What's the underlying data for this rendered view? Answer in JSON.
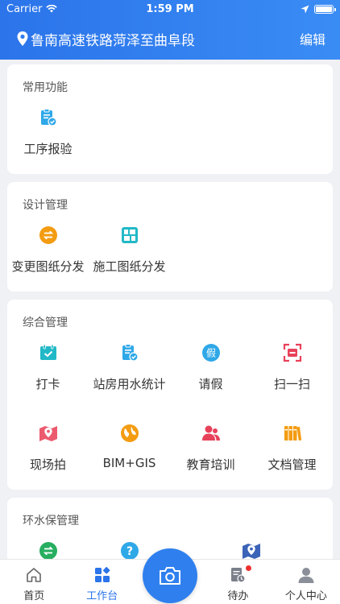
{
  "status": {
    "carrier": "Carrier",
    "time": "1:59 PM"
  },
  "header": {
    "title": "鲁南高速铁路菏泽至曲阜段",
    "edit": "编辑"
  },
  "sections": [
    {
      "title": "常用功能",
      "items": [
        {
          "label": "工序报验",
          "icon": "clipboard-check-icon"
        }
      ]
    },
    {
      "title": "设计管理",
      "items": [
        {
          "label": "变更图纸分发",
          "icon": "exchange-icon"
        },
        {
          "label": "施工图纸分发",
          "icon": "blueprint-icon"
        }
      ]
    },
    {
      "title": "综合管理",
      "items": [
        {
          "label": "打卡",
          "icon": "calendar-check-icon"
        },
        {
          "label": "站房用水统计",
          "icon": "clipboard-check-icon"
        },
        {
          "label": "请假",
          "icon": "leave-icon"
        },
        {
          "label": "扫一扫",
          "icon": "scan-icon"
        },
        {
          "label": "现场拍",
          "icon": "map-pin-icon"
        },
        {
          "label": "BIM+GIS",
          "icon": "globe-icon"
        },
        {
          "label": "教育培训",
          "icon": "users-icon"
        },
        {
          "label": "文档管理",
          "icon": "books-icon"
        }
      ]
    },
    {
      "title": "环水保管理",
      "items": [
        {
          "label": "",
          "icon": "exchange-icon"
        },
        {
          "label": "",
          "icon": "question-icon"
        },
        {
          "label": "",
          "icon": "map-pin-icon"
        }
      ]
    }
  ],
  "tabs": [
    {
      "label": "首页",
      "icon": "home-icon"
    },
    {
      "label": "工作台",
      "icon": "grid-icon"
    },
    {
      "label": "",
      "icon": "camera-icon"
    },
    {
      "label": "待办",
      "icon": "todo-icon"
    },
    {
      "label": "个人中心",
      "icon": "user-icon"
    }
  ],
  "colors": {
    "accent": "#2b74ea",
    "orange": "#f39c12",
    "red": "#e8415a",
    "teal": "#22b8c7",
    "green": "#27ae60"
  }
}
